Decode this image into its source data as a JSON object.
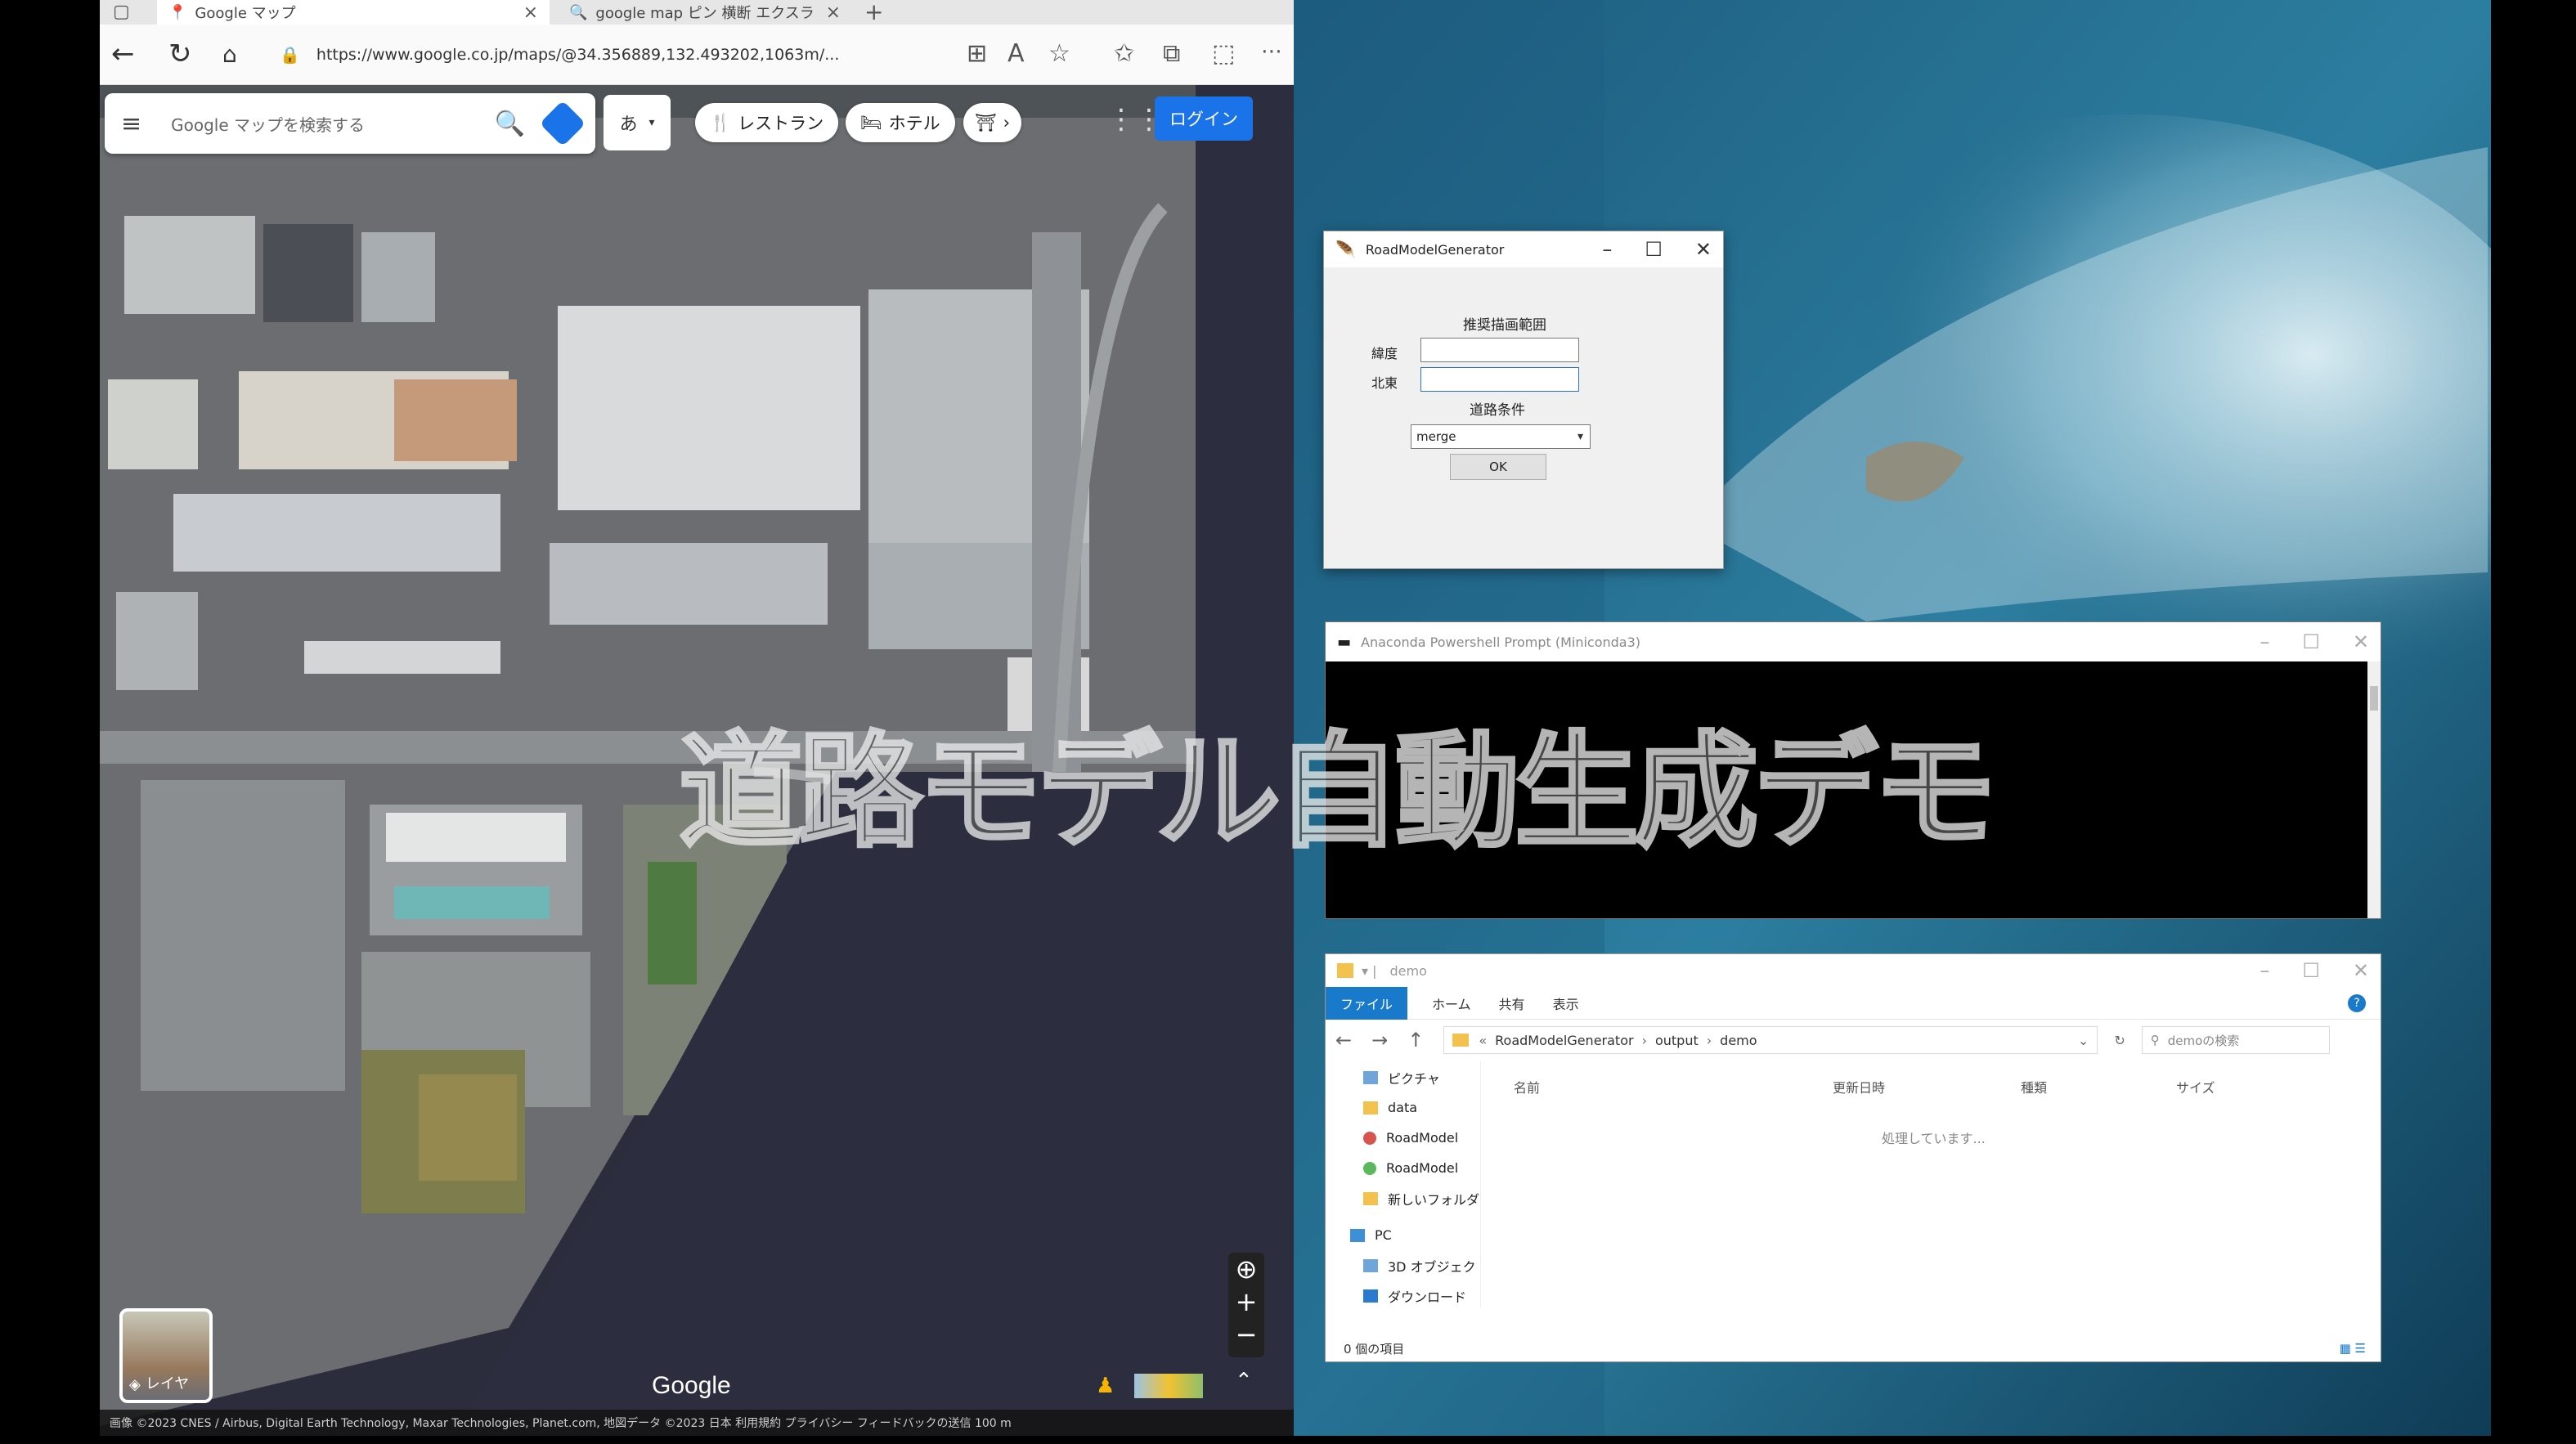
{
  "browser": {
    "tabs": [
      {
        "label": "Google マップ"
      },
      {
        "label": "google map ピン 横断 エクスラ"
      }
    ],
    "url": "https://www.google.co.jp/maps/@34.356889,132.493202,1063m/..."
  },
  "maps": {
    "search_placeholder": "Google マップを検索する",
    "lang": "あ",
    "chips": [
      "レストラン",
      "ホテル"
    ],
    "login": "ログイン",
    "layer_label": "レイヤ",
    "watermark": "Google",
    "attribution": "画像 ©2023 CNES / Airbus, Digital Earth Technology, Maxar Technologies, Planet.com, 地図データ ©2023   日本   利用規約   プライバシー   フィードバックの送信   100 m"
  },
  "dialog": {
    "title": "RoadModelGenerator",
    "heading": "推奨描画範囲",
    "label_lat": "緯度",
    "label_lon": "北東",
    "condition_heading": "道路条件",
    "select_value": "merge",
    "ok_label": "OK"
  },
  "console": {
    "title": "Anaconda Powershell Prompt (Miniconda3)"
  },
  "explorer": {
    "title": "demo",
    "ribbon": [
      "ファイル",
      "ホーム",
      "共有",
      "表示"
    ],
    "path": [
      "RoadModelGenerator",
      "output",
      "demo"
    ],
    "search_placeholder": "demoの検索",
    "nav_items": [
      {
        "label": "ピクチャ",
        "kind": "pic"
      },
      {
        "label": "data",
        "kind": "folder"
      },
      {
        "label": "RoadModel",
        "kind": "red"
      },
      {
        "label": "RoadModel",
        "kind": "green"
      },
      {
        "label": "新しいフォルダー",
        "kind": "folder"
      },
      {
        "label": "PC",
        "kind": "pc"
      },
      {
        "label": "3D オブジェクト",
        "kind": "pic"
      },
      {
        "label": "ダウンロード",
        "kind": "dl"
      }
    ],
    "columns": [
      "名前",
      "更新日時",
      "種類",
      "サイズ"
    ],
    "empty_message": "処理しています...",
    "status": "0 個の項目"
  },
  "overlay_caption": "道路モデル自動生成デモ"
}
